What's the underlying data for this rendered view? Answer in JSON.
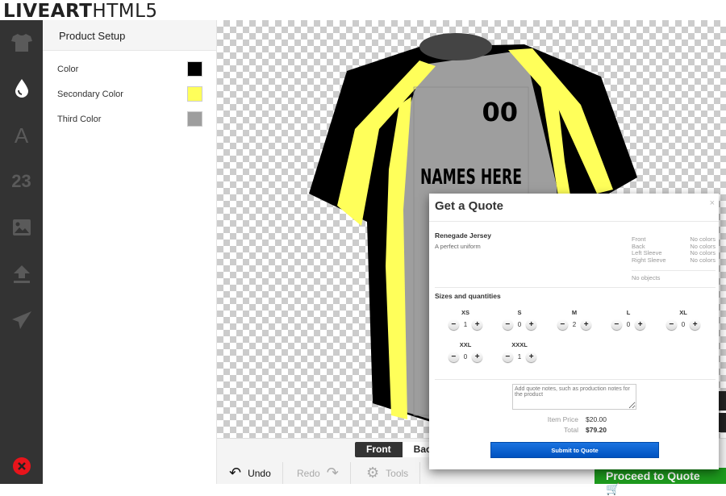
{
  "app": {
    "logo_bold": "LIVEART",
    "logo_light": "HTML5"
  },
  "sidebar": {
    "icons": [
      "tshirt-icon",
      "color-drop-icon",
      "text-icon",
      "numbers-icon",
      "image-icon",
      "upload-icon",
      "send-icon"
    ],
    "numbers_glyph": "23",
    "text_glyph": "A",
    "close_color": "#e8141b"
  },
  "panel": {
    "title": "Product Setup",
    "colors": [
      {
        "label": "Color",
        "value": "#000000"
      },
      {
        "label": "Secondary Color",
        "value": "#ffff5a"
      },
      {
        "label": "Third Color",
        "value": "#9e9e9e"
      }
    ]
  },
  "jersey": {
    "number": "00",
    "name": "NAMES HERE"
  },
  "view": {
    "front": "Front",
    "back": "Back"
  },
  "toolbar": {
    "undo": "Undo",
    "redo": "Redo",
    "tools": "Tools",
    "proceed": "Proceed to Quote"
  },
  "quote": {
    "title": "Get a Quote",
    "close": "×",
    "product_name": "Renegade Jersey",
    "product_desc": "A perfect uniform",
    "locations": [
      {
        "name": "Front",
        "value": "No colors"
      },
      {
        "name": "Back",
        "value": "No colors"
      },
      {
        "name": "Left Sleeve",
        "value": "No colors"
      },
      {
        "name": "Right Sleeve",
        "value": "No colors"
      }
    ],
    "objects": "No objects",
    "sizes_title": "Sizes and quantities",
    "sizes": [
      {
        "size": "XS",
        "qty": "1"
      },
      {
        "size": "S",
        "qty": "0"
      },
      {
        "size": "M",
        "qty": "2"
      },
      {
        "size": "L",
        "qty": "0"
      },
      {
        "size": "XL",
        "qty": "0"
      },
      {
        "size": "XXL",
        "qty": "0"
      },
      {
        "size": "XXXL",
        "qty": "1"
      }
    ],
    "minus": "−",
    "plus": "+",
    "notes_placeholder": "Add quote notes, such as production notes for the product",
    "item_price_label": "Item Price",
    "item_price": "$20.00",
    "total_label": "Total",
    "total": "$79.20",
    "submit": "Submit to Quote"
  }
}
